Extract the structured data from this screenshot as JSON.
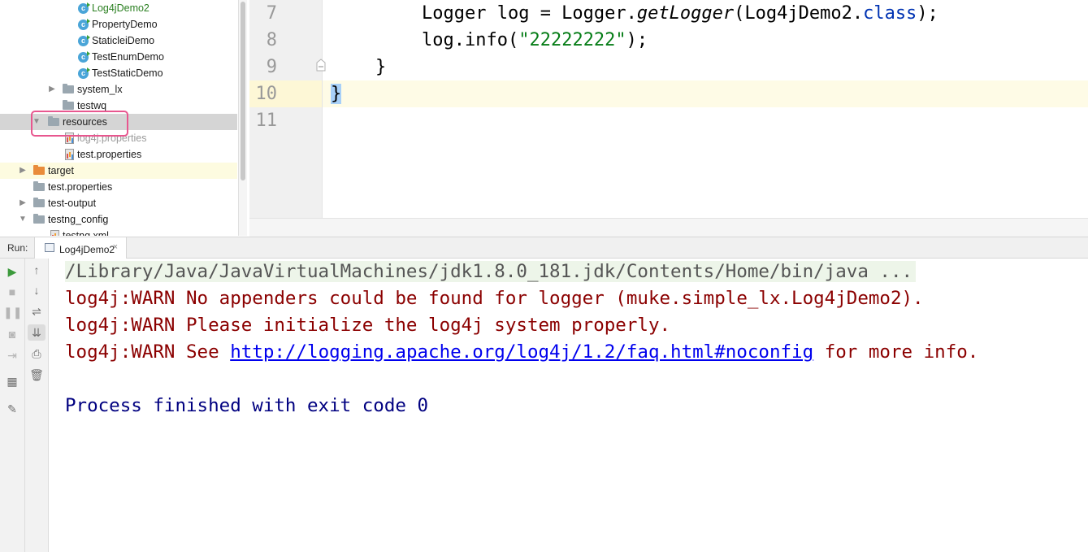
{
  "project_tree": {
    "items": [
      {
        "label": "Log4jDemo2",
        "kind": "class",
        "style": "green"
      },
      {
        "label": "PropertyDemo",
        "kind": "class"
      },
      {
        "label": "StaticleiDemo",
        "kind": "class"
      },
      {
        "label": "TestEnumDemo",
        "kind": "class"
      },
      {
        "label": "TestStaticDemo",
        "kind": "class"
      },
      {
        "label": "system_lx",
        "kind": "package"
      },
      {
        "label": "testwq",
        "kind": "package"
      },
      {
        "label": "resources",
        "kind": "folder",
        "selected": true,
        "highlight_color": "#e8578f"
      },
      {
        "label": "log4j.properties",
        "kind": "properties",
        "style": "dim"
      },
      {
        "label": "test.properties",
        "kind": "properties"
      },
      {
        "label": "target",
        "kind": "folder-orange"
      },
      {
        "label": "test.properties",
        "kind": "file"
      },
      {
        "label": "test-output",
        "kind": "folder"
      },
      {
        "label": "testng_config",
        "kind": "folder"
      },
      {
        "label": "testng.xml",
        "kind": "file"
      }
    ]
  },
  "editor": {
    "line_numbers": [
      "7",
      "8",
      "9",
      "10",
      "11"
    ],
    "lines": {
      "l7": {
        "a": "Logger log = Logger.",
        "b": "getLogger",
        "c": "(Log4jDemo2.",
        "d": "class",
        "e": ");"
      },
      "l8": {
        "a": "log.info(",
        "b": "\"22222222\"",
        "c": ");"
      },
      "l9": "}",
      "l10": "}"
    },
    "current_line_color": "#fefbe6"
  },
  "run_panel": {
    "label": "Run:",
    "tab_label": "Log4jDemo2",
    "tab_close": "×",
    "toolbar_left": [
      "run-icon",
      "stop-icon",
      "pause-icon",
      "camera-icon",
      "exit-icon",
      "layout-icon",
      "pin-icon"
    ],
    "toolbar_right": [
      "up-arrow-icon",
      "down-arrow-icon",
      "soft-wrap-icon",
      "scroll-to-end-icon",
      "print-icon",
      "trash-icon"
    ]
  },
  "console": {
    "command": "/Library/Java/JavaVirtualMachines/jdk1.8.0_181.jdk/Contents/Home/bin/java ...",
    "warn1": "log4j:WARN No appenders could be found for logger (muke.simple_lx.Log4jDemo2).",
    "warn2": "log4j:WARN Please initialize the log4j system properly.",
    "warn3_prefix": "log4j:WARN See ",
    "warn3_link": "http://logging.apache.org/log4j/1.2/faq.html#noconfig",
    "warn3_suffix": " for more info.",
    "exit": "Process finished with exit code 0",
    "colors": {
      "warn": "#8b0000",
      "link": "#0000ee",
      "exit": "#000080",
      "command_bg": "#edf5e9"
    }
  }
}
